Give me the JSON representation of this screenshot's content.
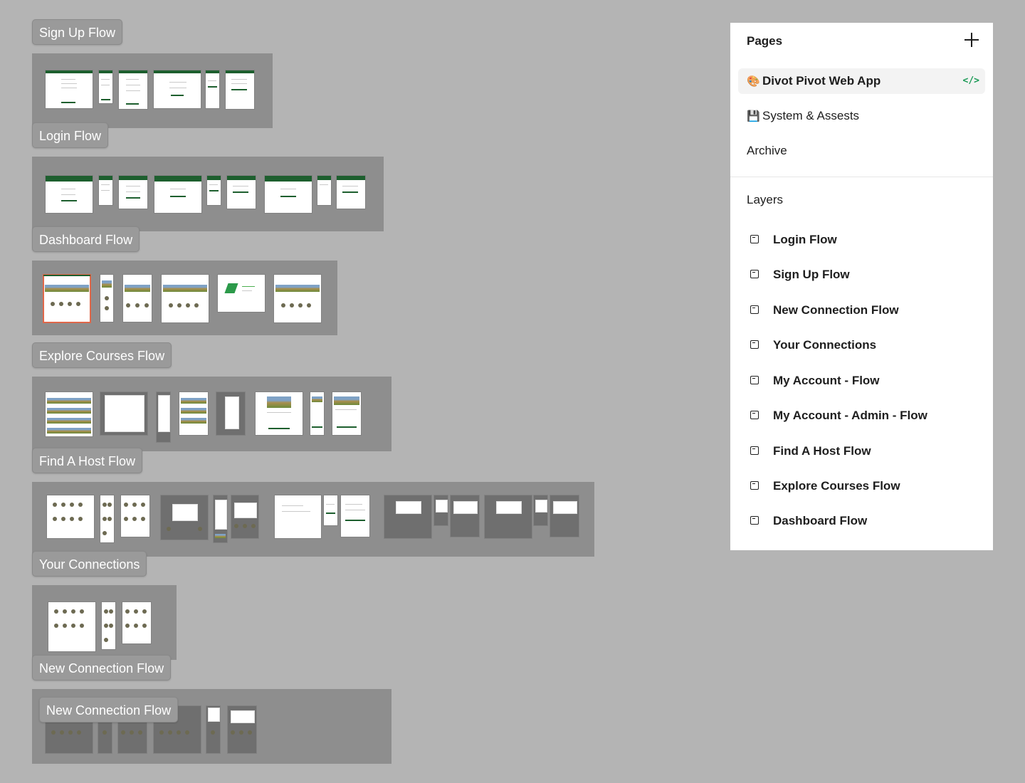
{
  "canvas": {
    "sections": [
      {
        "label": "Sign Up Flow"
      },
      {
        "label": "Login Flow"
      },
      {
        "label": "Dashboard Flow"
      },
      {
        "label": "Explore Courses Flow"
      },
      {
        "label": "Find A Host Flow"
      },
      {
        "label": "Your Connections"
      },
      {
        "label": "New Connection Flow"
      },
      {
        "label": "New Connection Flow"
      }
    ]
  },
  "panel": {
    "pages_title": "Pages",
    "pages": [
      {
        "emoji": "🎨",
        "label": "Divot Pivot Web App",
        "active": true,
        "code_icon": "</>"
      },
      {
        "emoji": "💾",
        "label": "System & Assests",
        "active": false
      },
      {
        "emoji": "",
        "label": "Archive",
        "active": false
      }
    ],
    "layers_title": "Layers",
    "layers": [
      "Login Flow",
      "Sign Up Flow",
      "New Connection Flow",
      "Your Connections",
      "My Account - Flow",
      "My Account - Admin - Flow",
      "Find A Host Flow",
      "Explore Courses Flow",
      "Dashboard Flow"
    ]
  },
  "colors": {
    "canvas": "#b4b4b4",
    "section_frame": "#8e8e8e",
    "brand_green": "#1d5f2e",
    "code_icon": "#1a9a55"
  }
}
